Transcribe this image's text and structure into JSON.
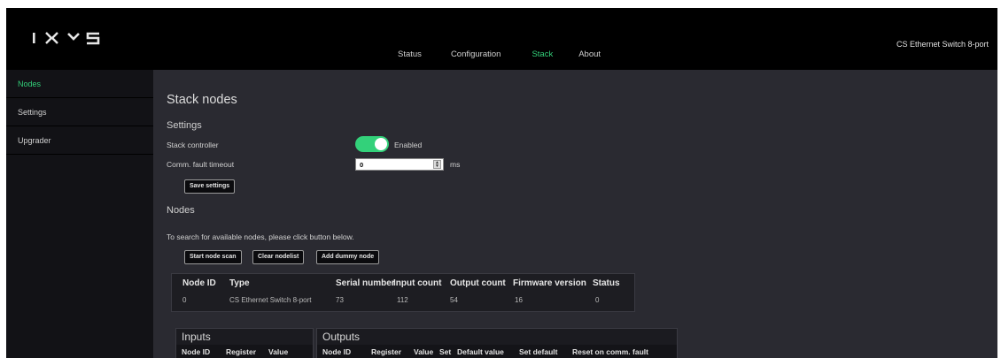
{
  "app": {
    "logo_text": "IXYS",
    "product_name": "CS Ethernet Switch 8-port"
  },
  "nav": {
    "tabs": [
      {
        "label": "Status"
      },
      {
        "label": "Configuration"
      },
      {
        "label": "Stack",
        "active": true
      },
      {
        "label": "About"
      }
    ]
  },
  "sidebar": {
    "items": [
      {
        "label": "Nodes",
        "active": true
      },
      {
        "label": "Settings"
      },
      {
        "label": "Upgrader"
      }
    ]
  },
  "page": {
    "title": "Stack nodes",
    "settings_heading": "Settings",
    "stack_controller_label": "Stack controller",
    "stack_controller_state": "Enabled",
    "stack_controller_on": true,
    "timeout_label": "Comm. fault timeout",
    "timeout_value": "0",
    "timeout_unit": "ms",
    "save_button": "Save settings",
    "nodes_heading": "Nodes",
    "help_text": "To search for available nodes, please click button below.",
    "buttons": {
      "start_scan": "Start node scan",
      "clear_list": "Clear nodelist",
      "add_dummy": "Add dummy node"
    }
  },
  "nodes_table": {
    "headers": [
      "Node ID",
      "Type",
      "Serial number",
      "Input count",
      "Output count",
      "Firmware version",
      "Status"
    ],
    "rows": [
      [
        "0",
        "CS Ethernet Switch 8-port",
        "73",
        "112",
        "54",
        "16",
        "0"
      ]
    ]
  },
  "inputs_panel": {
    "title": "Inputs",
    "headers": [
      "Node ID",
      "Register",
      "Value"
    ]
  },
  "outputs_panel": {
    "title": "Outputs",
    "headers": [
      "Node ID",
      "Register",
      "Value",
      "Set",
      "Default value",
      "Set default",
      "Reset on comm. fault"
    ]
  },
  "colors": {
    "accent_green": "#33d17a",
    "topbar": "#000000",
    "sidebar": "#121216",
    "content": "#2a2a31"
  }
}
